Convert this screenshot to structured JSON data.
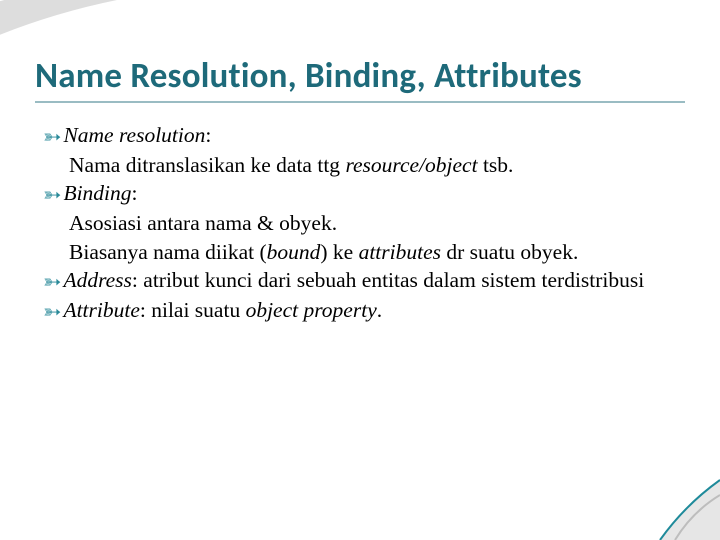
{
  "slide": {
    "title": "Name Resolution, Binding, Attributes"
  },
  "bullets": {
    "b0": {
      "lead_before": "",
      "lead_ital": "Name resolution",
      "lead_after": ":",
      "sub1_before": "Nama ditranslasikan ke data ttg ",
      "sub1_ital": "resource/object",
      "sub1_after": " tsb."
    },
    "b1": {
      "lead_ital": "Binding",
      "lead_after": ":",
      "sub1": "Asosiasi antara nama & obyek.",
      "sub2_before": "Biasanya nama diikat (",
      "sub2_ital1": "bound",
      "sub2_mid": ") ke ",
      "sub2_ital2": "attributes",
      "sub2_after": " dr suatu obyek."
    },
    "b2": {
      "lead_ital": "Address",
      "lead_after": ": atribut kunci dari sebuah entitas dalam sistem terdistribusi"
    },
    "b3": {
      "lead_ital": "Attribute",
      "lead_after": ":  nilai suatu ",
      "tail_ital": "object property",
      "tail_after": "."
    }
  }
}
